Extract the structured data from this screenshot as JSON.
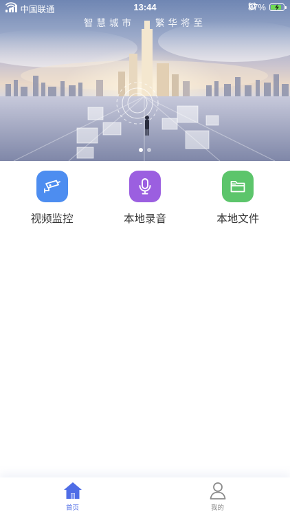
{
  "status_bar": {
    "carrier": "中国联通",
    "time": "13:44",
    "battery_text": "87%",
    "battery_level": 0.87,
    "wifi_icon": "wifi-icon",
    "alarm_icon": "alarm-icon"
  },
  "banner": {
    "slogan_left": "智慧城市",
    "slogan_right": "繁华将至",
    "page_count": 2,
    "active_page": 0
  },
  "features": [
    {
      "label": "视频监控",
      "icon": "cctv-camera-icon",
      "color": "#4d8df0"
    },
    {
      "label": "本地录音",
      "icon": "microphone-icon",
      "color": "#9b5fe0"
    },
    {
      "label": "本地文件",
      "icon": "folder-icon",
      "color": "#5cc56b"
    }
  ],
  "tabbar": {
    "items": [
      {
        "label": "首页",
        "icon": "home-icon",
        "active": true
      },
      {
        "label": "我的",
        "icon": "user-icon",
        "active": false
      }
    ],
    "active_color": "#4f6de6"
  }
}
